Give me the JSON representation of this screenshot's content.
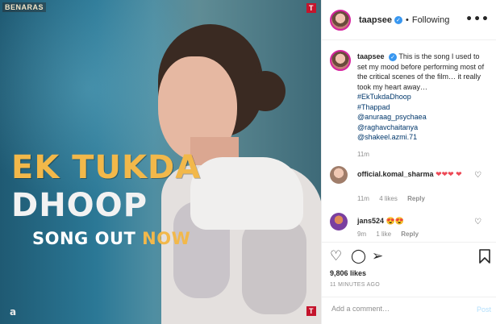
{
  "media": {
    "brand_logo": "BENARAS",
    "tseries_logo": "T",
    "title_line1": "EK TUKDA",
    "title_line2": "DHOOP",
    "song_out_word1": "SONG OUT",
    "song_out_word2": "NOW",
    "corner_logo": "a"
  },
  "header": {
    "username": "taapsee",
    "verified_mark": "✓",
    "separator": "•",
    "follow_label": "Following",
    "more_label": "•••"
  },
  "caption": {
    "username": "taapsee",
    "verified_mark": "✓",
    "text": "This is the song I used to set my mood before performing most of the critical scenes of the film… it really took my heart away…",
    "tags": [
      "#EkTukdaDhoop",
      "#Thappad",
      "@anuraag_psychaea",
      "@raghavchaitanya",
      "@shakeel.azmi.71"
    ],
    "time": "11m"
  },
  "comments": [
    {
      "username": "official.komal_sharma",
      "text": "❤❤❤ ❤",
      "time": "11m",
      "likes": "4 likes",
      "reply": "Reply"
    },
    {
      "username": "jans524",
      "text": "😍😍",
      "time": "9m",
      "likes": "1 like",
      "reply": "Reply"
    }
  ],
  "actions": {
    "likes": "9,806 likes",
    "time_ago": "11 MINUTES AGO"
  },
  "add_comment": {
    "placeholder": "Add a comment…",
    "post_label": "Post"
  },
  "colors": {
    "accent_yellow": "#f2b84a",
    "link": "#00376b",
    "verified": "#3897f0",
    "heart": "#ed4956"
  },
  "icons": [
    "heart-icon",
    "comment-icon",
    "share-icon",
    "bookmark-icon",
    "more-icon",
    "verified-icon"
  ]
}
